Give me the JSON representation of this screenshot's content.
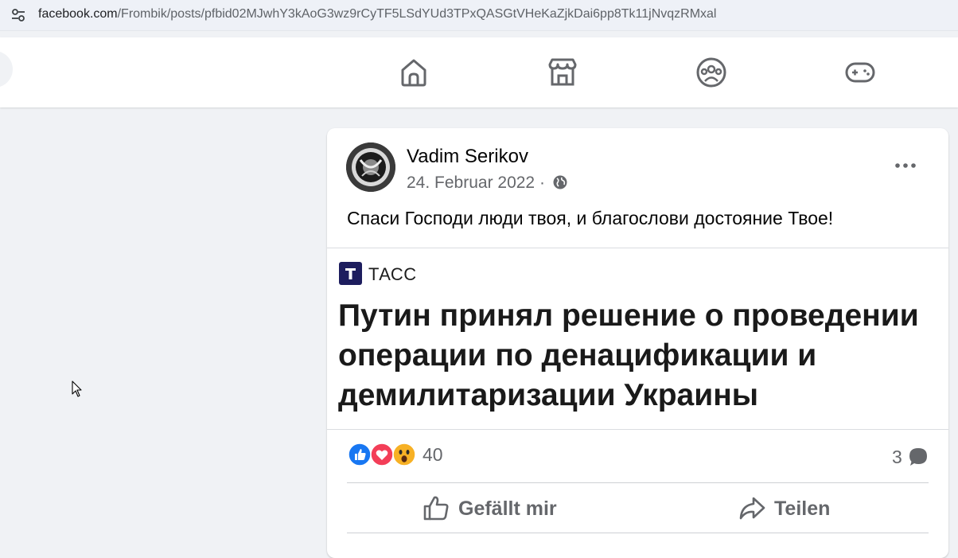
{
  "browser": {
    "url_host": "facebook.com",
    "url_path": "/Frombik/posts/pfbid02MJwhY3kAoG3wz9rCyTF5LSdYUd3TPxQASGtVHeKaZjkDai6pp8Tk11jNvqzRMxal"
  },
  "nav": {
    "icons": [
      "home-icon",
      "marketplace-icon",
      "groups-icon",
      "gaming-icon"
    ]
  },
  "post": {
    "author": "Vadim Serikov",
    "date": "24. Februar 2022 ·",
    "text": "Спаси Господи люди твоя, и благослови достояние Твое!",
    "embed": {
      "source": "ТАСС",
      "logo_letter": "Т",
      "headline": "Путин принял решение о проведении операции по денацификации и демилитаризации Украины"
    },
    "reaction_count": "40",
    "comment_count": "3",
    "actions": {
      "like": "Gefällt mir",
      "share": "Teilen"
    }
  },
  "colors": {
    "fb_gray_text": "#65676b",
    "like_blue": "#1877f2",
    "love_red": "#f33e58",
    "wow_yellow": "#f7b125",
    "tass_navy": "#1d1d5e"
  }
}
